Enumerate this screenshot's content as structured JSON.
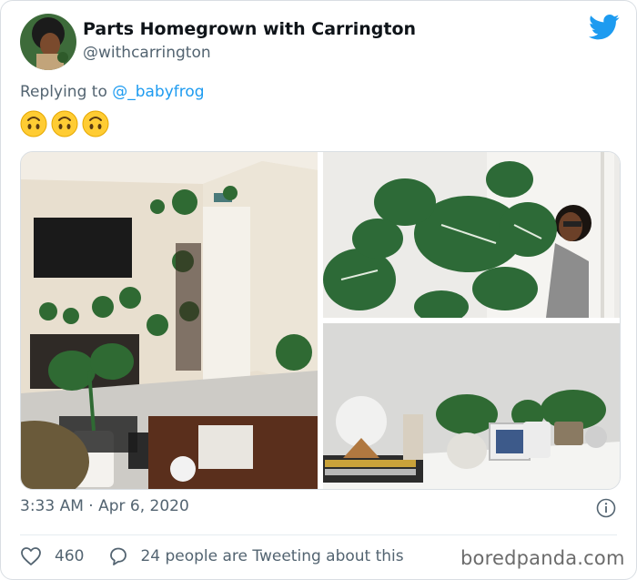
{
  "user": {
    "display_name": "Parts Homegrown with Carrington",
    "handle": "@withcarrington"
  },
  "reply": {
    "prefix": "Replying to ",
    "mention": "@_babyfrog"
  },
  "emojis": [
    "upside-down-face",
    "upside-down-face",
    "upside-down-face"
  ],
  "timestamp": "3:33 AM · Apr 6, 2020",
  "actions": {
    "likes": "460",
    "comments": "24 people are Tweeting about this"
  },
  "watermark": "boredpanda.com",
  "colors": {
    "twitter_blue": "#1d9bf0",
    "text": "#0f1419",
    "secondary": "#536471"
  }
}
